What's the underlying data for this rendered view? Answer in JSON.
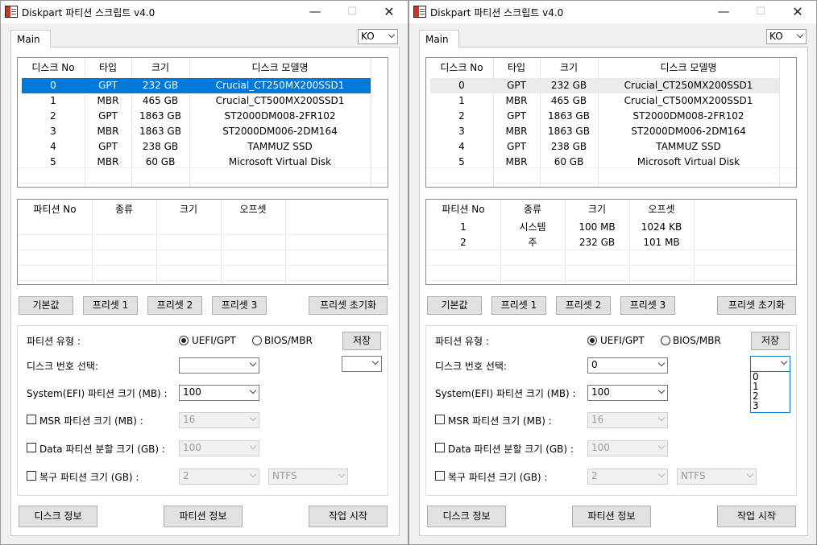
{
  "title": "Diskpart 파티션 스크립트 v4.0",
  "titlebar": {
    "minimize_glyph": "—",
    "maximize_glyph": "☐",
    "close_glyph": "✕"
  },
  "tab_main": "Main",
  "language": "KO",
  "disk_headers": [
    "디스크 No",
    "타입",
    "크기",
    "디스크 모델명"
  ],
  "disks": [
    {
      "no": "0",
      "type": "GPT",
      "size": "232 GB",
      "model": "Crucial_CT250MX200SSD1"
    },
    {
      "no": "1",
      "type": "MBR",
      "size": "465 GB",
      "model": "Crucial_CT500MX200SSD1"
    },
    {
      "no": "2",
      "type": "GPT",
      "size": "1863 GB",
      "model": "ST2000DM008-2FR102"
    },
    {
      "no": "3",
      "type": "MBR",
      "size": "1863 GB",
      "model": "ST2000DM006-2DM164"
    },
    {
      "no": "4",
      "type": "GPT",
      "size": "238 GB",
      "model": "TAMMUZ SSD"
    },
    {
      "no": "5",
      "type": "MBR",
      "size": "60 GB",
      "model": "Microsoft Virtual Disk"
    }
  ],
  "partition_headers": [
    "파티션 No",
    "종류",
    "크기",
    "오프셋"
  ],
  "partitions_right": [
    {
      "no": "1",
      "kind": "시스템",
      "size": "100 MB",
      "offset": "1024 KB"
    },
    {
      "no": "2",
      "kind": "주",
      "size": "232 GB",
      "offset": "101 MB"
    }
  ],
  "buttons": {
    "default": "기본값",
    "preset1": "프리셋 1",
    "preset2": "프리셋 2",
    "preset3": "프리셋 3",
    "preset_reset": "프리셋 초기화",
    "save": "저장",
    "disk_info": "디스크 정보",
    "partition_info": "파티션 정보",
    "start": "작업 시작"
  },
  "form": {
    "partition_type_label": "파티션 유형 :",
    "uefi_label": "UEFI/GPT",
    "bios_label": "BIOS/MBR",
    "disk_select_label": "디스크 번호 선택:",
    "efi_size_label": "System(EFI) 파티션 크기 (MB) :",
    "efi_size_value": "100",
    "msr_label": "MSR 파티션 크기 (MB) :",
    "msr_value": "16",
    "data_split_label": "Data 파티션 분할 크기 (GB) :",
    "data_split_value": "100",
    "recovery_label": "복구 파티션 크기 (GB) :",
    "recovery_value": "2",
    "fs_value": "NTFS"
  },
  "left": {
    "disk_select_value": "",
    "extra_value": ""
  },
  "right": {
    "disk_select_value": "0",
    "extra_value": "",
    "extra_options": [
      "0",
      "1",
      "2",
      "3"
    ]
  }
}
